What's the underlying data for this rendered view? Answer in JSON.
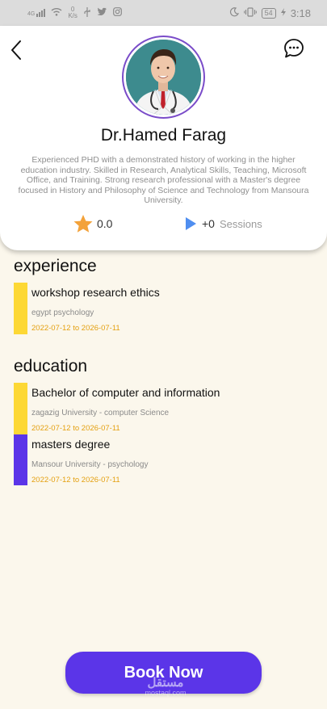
{
  "status_bar": {
    "signal": "4G",
    "net_speed_value": "0",
    "net_speed_unit": "K/s",
    "battery": "54",
    "time": "3:18"
  },
  "profile": {
    "name": "Dr.Hamed Farag",
    "bio": "Experienced PHD with a demonstrated history of working in the higher education industry. Skilled in Research, Analytical Skills, Teaching, Microsoft Office, and Training. Strong research professional with a Master's degree focused in History and Philosophy of Science and Technology from Mansoura University.",
    "rating": "0.0",
    "sessions_count": "+0",
    "sessions_label": "Sessions"
  },
  "experience": {
    "title": "experience",
    "items": [
      {
        "title": "workshop research ethics",
        "subtitle": "egypt psychology",
        "dates": "2022-07-12 to 2026-07-11",
        "color": "#fdd835"
      }
    ]
  },
  "education": {
    "title": "education",
    "items": [
      {
        "title": "Bachelor of computer and information",
        "subtitle": "zagazig University  - computer Science",
        "dates": "2022-07-12 to 2026-07-11",
        "color": "#fdd835"
      },
      {
        "title": "masters degree",
        "subtitle": "Mansour University  - psychology",
        "dates": "2022-07-12 to 2026-07-11",
        "color": "#5b35e8"
      }
    ]
  },
  "book_button": {
    "label": "Book Now"
  },
  "watermark": {
    "arabic": "مستقل",
    "latin": "mostaql.com"
  },
  "colors": {
    "accent": "#5b35e8",
    "highlight": "#fdd835",
    "date_text": "#e4a010",
    "background": "#fbf7ec",
    "star": "#f3a23a",
    "play": "#4f8ef0"
  },
  "icons": {
    "back": "chevron-left-icon",
    "chat": "chat-bubble-icon",
    "rating": "star-icon",
    "sessions": "play-icon"
  }
}
